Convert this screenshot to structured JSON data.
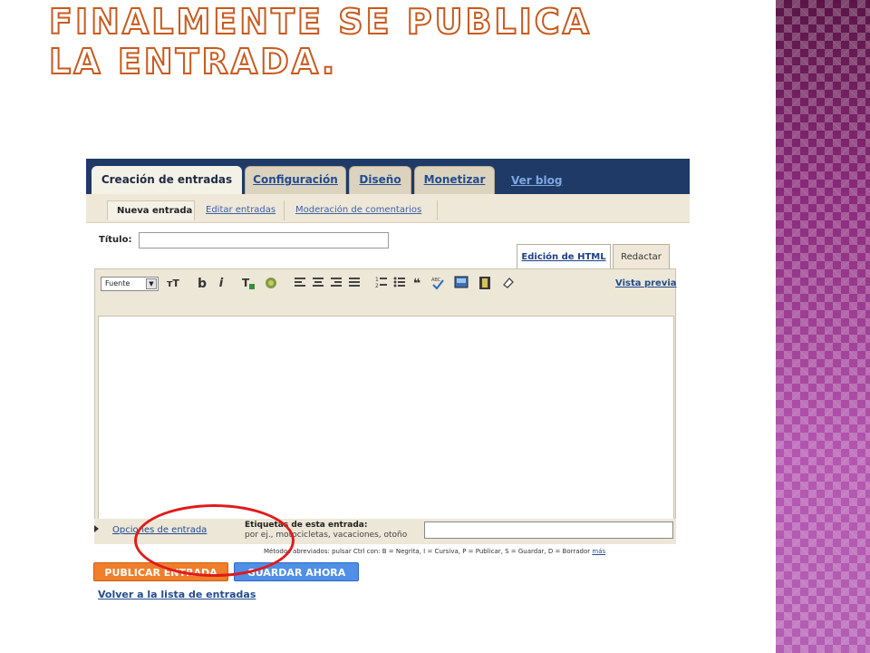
{
  "slide": {
    "title": "Finalmente se publica la entrada."
  },
  "blogger": {
    "tabs": [
      "Creación de entradas",
      "Configuración",
      "Diseño",
      "Monetizar"
    ],
    "view_blog_link": "Ver blog",
    "subtabs": [
      "Nueva entrada",
      "Editar entradas",
      "Moderación de comentarios"
    ],
    "title_label": "Título:",
    "title_value": "",
    "mode_tabs": [
      "Edición de HTML",
      "Redactar"
    ],
    "toolbar": {
      "font_select": "Fuente",
      "font_size_icon": "ᴛT",
      "bold": "b",
      "italic": "i",
      "preview_link": "Vista previa"
    },
    "post_options_link": "Opciones de entrada",
    "labels_title": "Etiquetas de esta entrada:",
    "labels_hint": "por ej., motocicletas, vacaciones, otoño",
    "labels_value": "",
    "shortcuts_text": "Métodos abreviados: pulsar Ctrl con: B = Negrita, I = Cursiva, P = Publicar, S = Guardar, D = Borrador",
    "shortcuts_more": "más",
    "publish_button": "PUBLICAR ENTRADA",
    "save_button": "GUARDAR AHORA",
    "back_link": "Volver a la lista de entradas"
  },
  "colors": {
    "tabbar": "#1f3a67",
    "publish": "#f07e2a",
    "save": "#4f8fe8",
    "highlight": "#e01b1b",
    "title_outline": "#c85a1e"
  }
}
